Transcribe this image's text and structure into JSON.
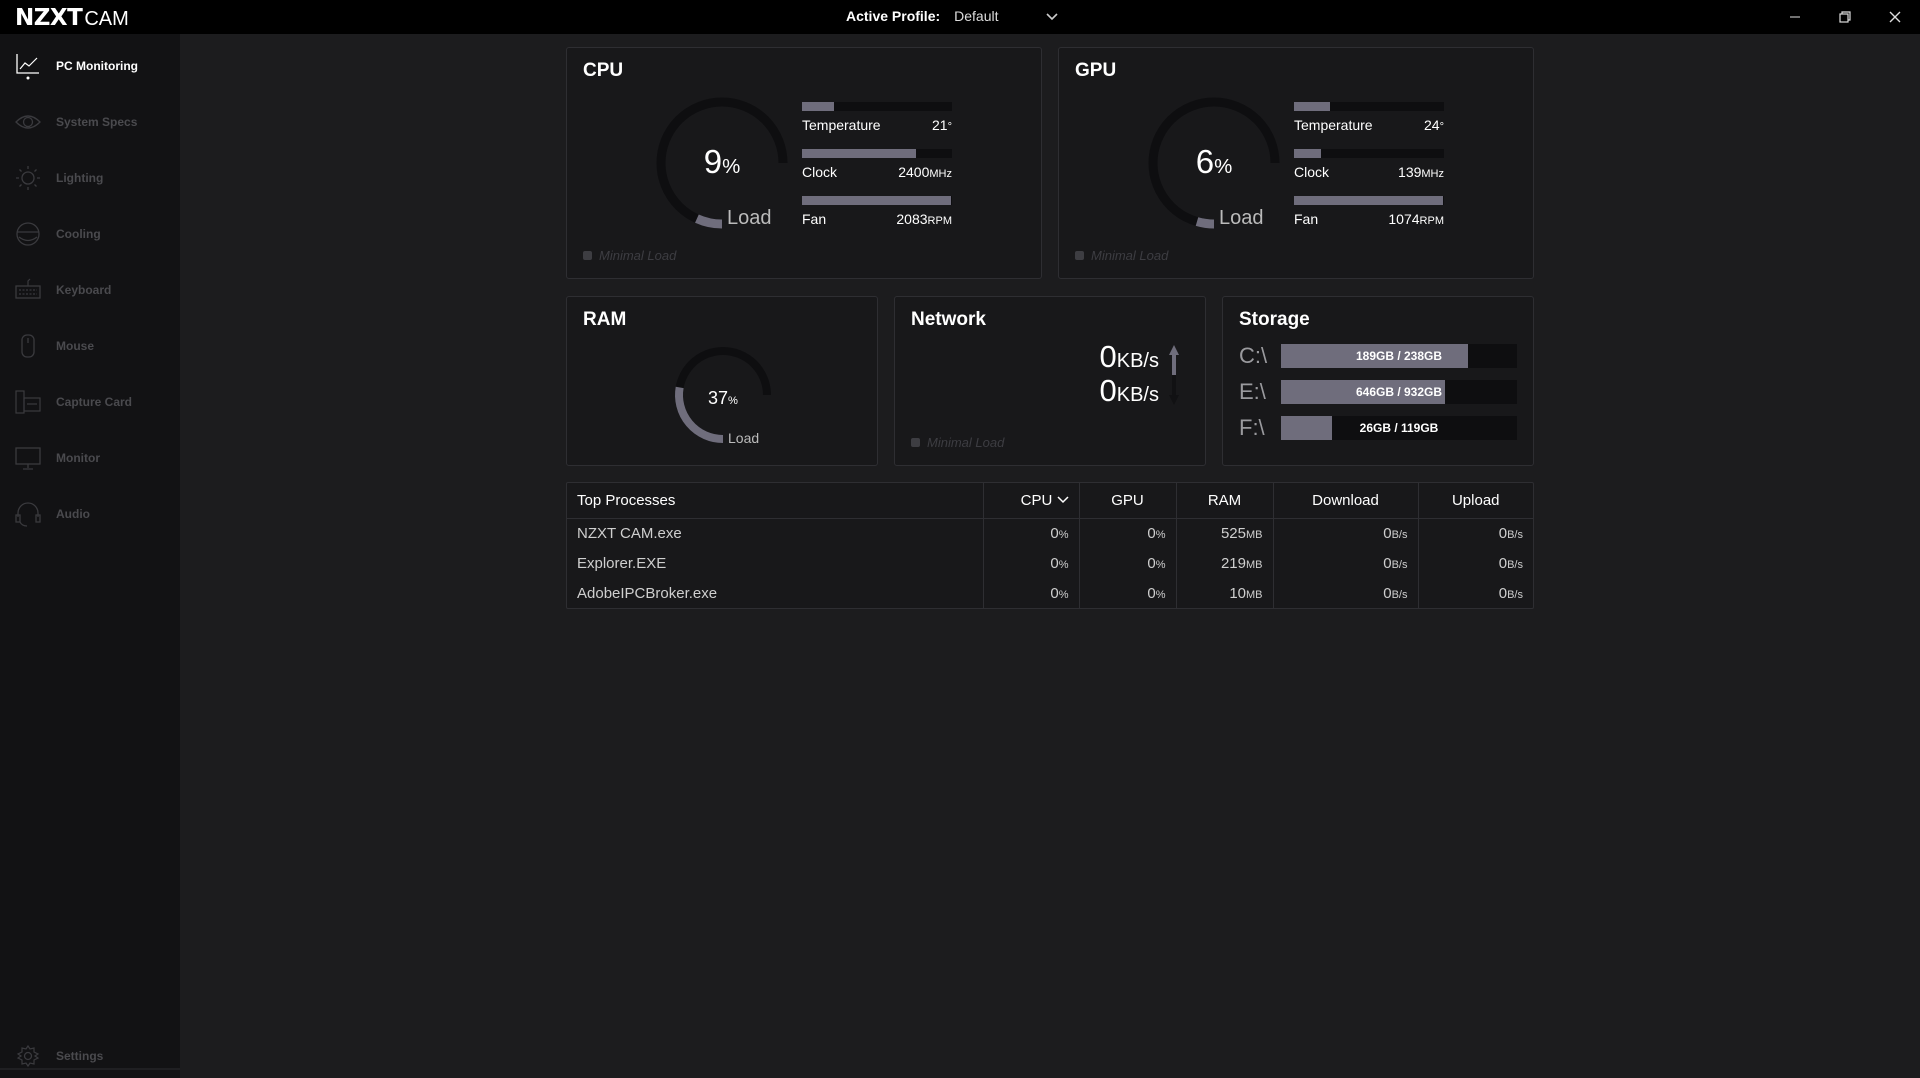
{
  "app": {
    "brand": "NZXT",
    "product": "CAM"
  },
  "titlebar": {
    "profile_label": "Active Profile:",
    "profile_value": "Default",
    "window_controls": [
      "minimize-icon",
      "restore-icon",
      "close-icon"
    ]
  },
  "sidebar": {
    "items": [
      {
        "label": "PC Monitoring",
        "icon": "chart-line-icon",
        "active": true
      },
      {
        "label": "System Specs",
        "icon": "eye-icon",
        "active": false
      },
      {
        "label": "Lighting",
        "icon": "sun-icon",
        "active": false
      },
      {
        "label": "Cooling",
        "icon": "cooling-icon",
        "active": false
      },
      {
        "label": "Keyboard",
        "icon": "keyboard-icon",
        "active": false
      },
      {
        "label": "Mouse",
        "icon": "mouse-icon",
        "active": false
      },
      {
        "label": "Capture Card",
        "icon": "capture-card-icon",
        "active": false
      },
      {
        "label": "Monitor",
        "icon": "monitor-icon",
        "active": false
      },
      {
        "label": "Audio",
        "icon": "headset-icon",
        "active": false
      }
    ],
    "settings_label": "Settings"
  },
  "cpu": {
    "title": "CPU",
    "load_value": "9",
    "load_unit": "%",
    "load_fraction": 0.09,
    "load_label": "Load",
    "metrics": [
      {
        "label": "Temperature",
        "value": "21",
        "unit": "°",
        "fill": 0.21
      },
      {
        "label": "Clock",
        "value": "2400",
        "unit": "MHz",
        "fill": 0.76
      },
      {
        "label": "Fan",
        "value": "2083",
        "unit": "RPM",
        "fill": 0.99
      }
    ],
    "status": "Minimal Load"
  },
  "gpu": {
    "title": "GPU",
    "load_value": "6",
    "load_unit": "%",
    "load_fraction": 0.06,
    "load_label": "Load",
    "metrics": [
      {
        "label": "Temperature",
        "value": "24",
        "unit": "°",
        "fill": 0.24
      },
      {
        "label": "Clock",
        "value": "139",
        "unit": "MHz",
        "fill": 0.18
      },
      {
        "label": "Fan",
        "value": "1074",
        "unit": "RPM",
        "fill": 0.99
      }
    ],
    "status": "Minimal Load"
  },
  "ram": {
    "title": "RAM",
    "load_value": "37",
    "load_unit": "%",
    "load_fraction": 0.37,
    "load_label": "Load"
  },
  "network": {
    "title": "Network",
    "upload_value": "0",
    "upload_unit": "KB/s",
    "download_value": "0",
    "download_unit": "KB/s",
    "status": "Minimal Load"
  },
  "storage": {
    "title": "Storage",
    "drives": [
      {
        "letter": "C:\\",
        "text": "189GB / 238GB",
        "fill": 0.794
      },
      {
        "letter": "E:\\",
        "text": "646GB / 932GB",
        "fill": 0.693
      },
      {
        "letter": "F:\\",
        "text": "26GB / 119GB",
        "fill": 0.218
      }
    ]
  },
  "processes": {
    "headers": {
      "name": "Top Processes",
      "cpu": "CPU",
      "gpu": "GPU",
      "ram": "RAM",
      "download": "Download",
      "upload": "Upload"
    },
    "sort_column": "CPU",
    "rows": [
      {
        "name": "NZXT CAM.exe",
        "cpu": "0",
        "gpu": "0",
        "ram": "525",
        "download": "0",
        "upload": "0"
      },
      {
        "name": "Explorer.EXE",
        "cpu": "0",
        "gpu": "0",
        "ram": "219",
        "download": "0",
        "upload": "0"
      },
      {
        "name": "AdobeIPCBroker.exe",
        "cpu": "0",
        "gpu": "0",
        "ram": "10",
        "download": "0",
        "upload": "0"
      }
    ],
    "units": {
      "pct": "%",
      "mem": "MB",
      "rate": "B/s"
    }
  },
  "colors": {
    "accent_fill": "#6f6d7c",
    "track": "#0e0e10",
    "panel_bg": "#18181a",
    "app_bg": "#1c1c1e",
    "sidebar_bg": "#121214"
  }
}
